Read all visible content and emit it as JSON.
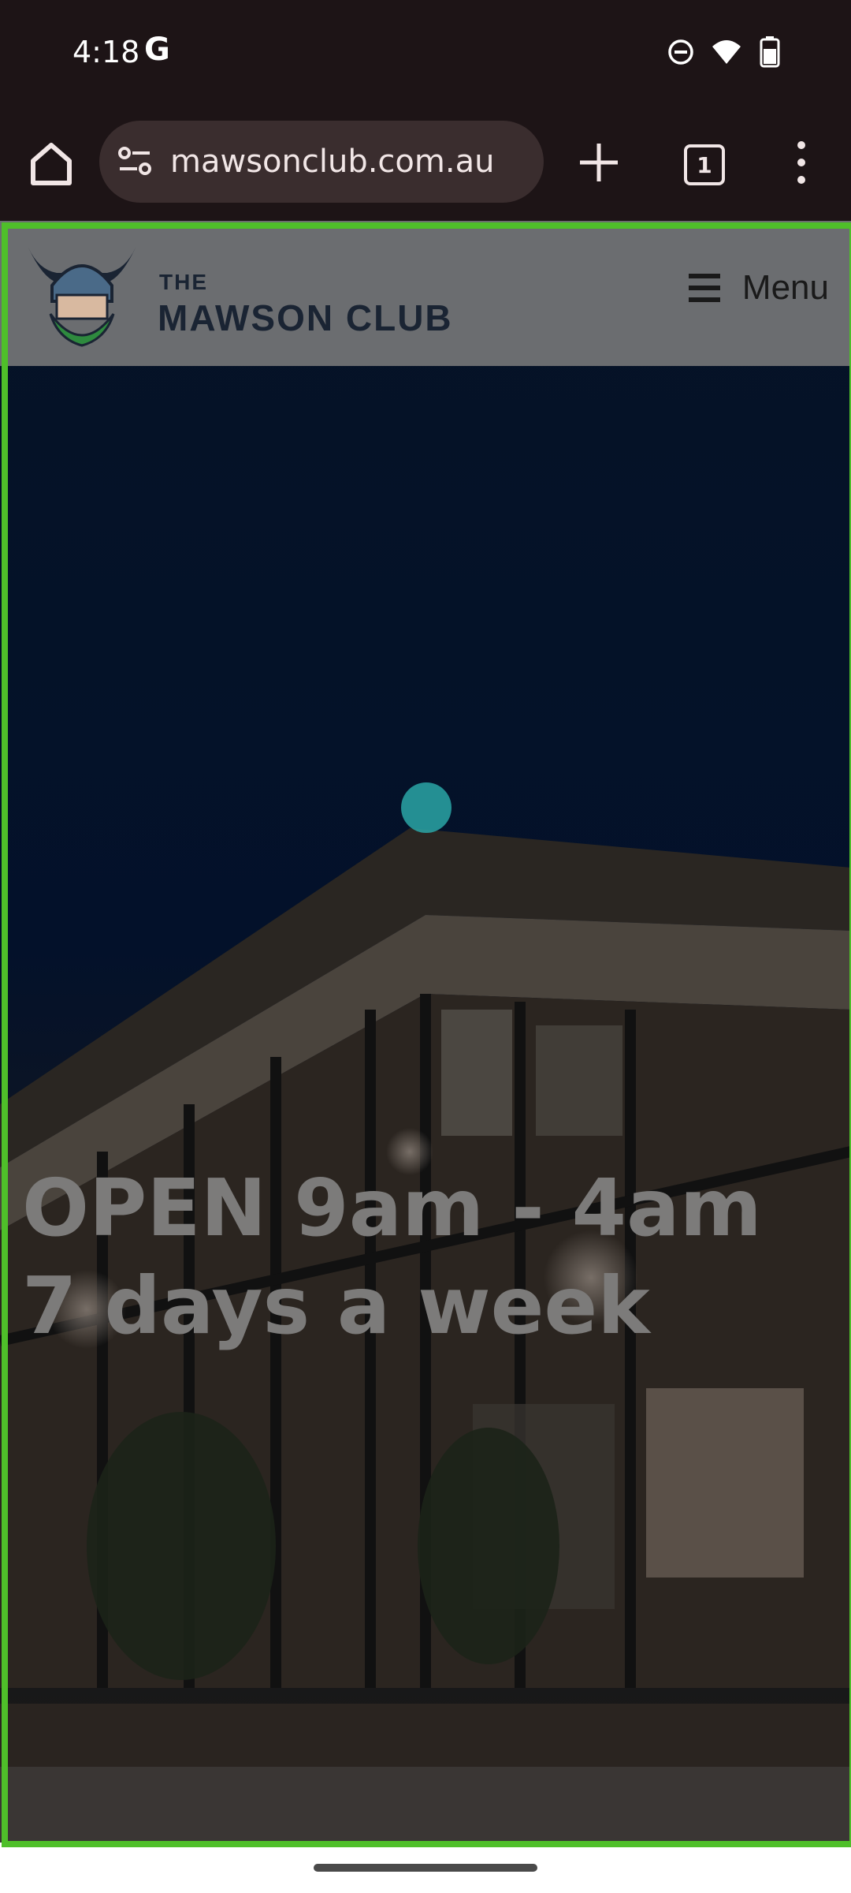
{
  "status_bar": {
    "time": "4:18",
    "google_indicator": "G",
    "icons": [
      "do-not-disturb-icon",
      "wifi-icon",
      "battery-icon"
    ]
  },
  "browser": {
    "url": "mawsonclub.com.au",
    "tab_count": "1"
  },
  "site": {
    "brand_line1": "THE",
    "brand_line2": "MAWSON CLUB",
    "menu_label": "Menu",
    "hero_title": "OPEN 9am - 4am 7 days a week"
  },
  "colors": {
    "frame": "#4fbf2a",
    "tap_indicator": "#2aa6a6"
  }
}
